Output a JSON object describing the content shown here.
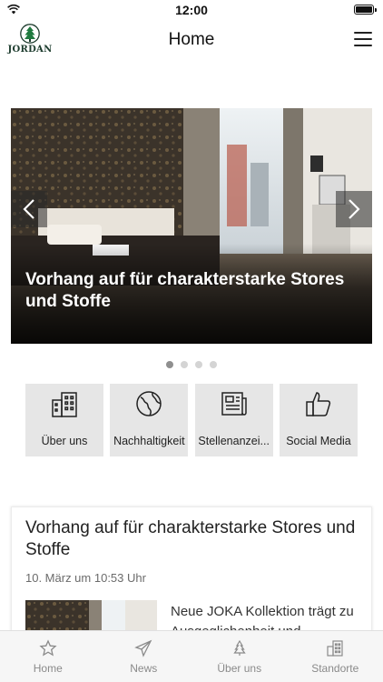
{
  "status_bar": {
    "time": "12:00",
    "battery_level": 1.0,
    "icons": [
      "wifi-icon",
      "battery-icon"
    ]
  },
  "nav": {
    "logo_text": "JORDAN",
    "title": "Home",
    "menu_icon": "hamburger-menu-icon"
  },
  "carousel": {
    "caption": "Vorhang auf für charakterstarke Stores und Stoffe",
    "slide_count": 4,
    "active_slide": 1,
    "prev_icon": "chevron-left-icon",
    "next_icon": "chevron-right-icon"
  },
  "tiles": [
    {
      "label": "Über uns",
      "icon": "building-icon"
    },
    {
      "label": "Nachhaltigkeit",
      "icon": "globe-icon"
    },
    {
      "label": "Stellenanzei...",
      "icon": "newspaper-icon"
    },
    {
      "label": "Social Media",
      "icon": "thumbs-up-icon"
    }
  ],
  "news_card": {
    "title": "Vorhang auf für charakterstarke Stores und Stoffe",
    "date": "10. März um 10:53 Uhr",
    "excerpt": "Neue JOKA Kollektion trägt zu Ausgeglichenheit und"
  },
  "tab_bar": [
    {
      "label": "Home",
      "icon": "star-icon"
    },
    {
      "label": "News",
      "icon": "paper-plane-icon"
    },
    {
      "label": "Über uns",
      "icon": "tree-icon"
    },
    {
      "label": "Standorte",
      "icon": "building-icon"
    }
  ],
  "colors": {
    "tile_background": "#e6e6e6",
    "tab_bar_background": "#f6f6f6",
    "tab_label": "#8a8a8a",
    "logo_green": "#1d3c2e",
    "dot_active": "#8f8f8f",
    "dot_inactive": "#d4d4d4"
  }
}
